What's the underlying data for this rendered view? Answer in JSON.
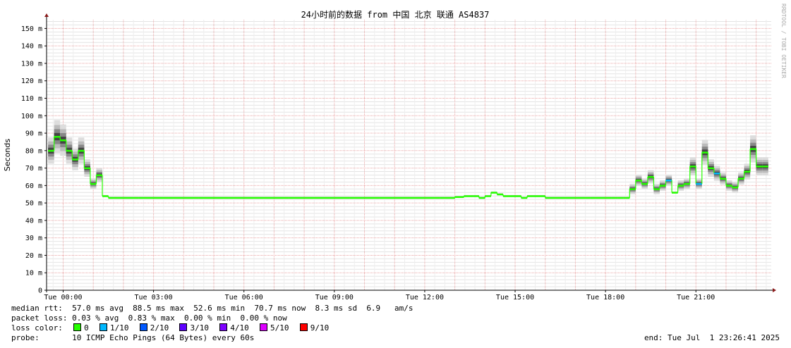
{
  "chart_data": {
    "type": "line",
    "title": "24小时前的数据 from 中国 北京 联通 AS4837",
    "ylabel": "Seconds",
    "watermark": "RRDTOOL / TOBI OETIKER",
    "ylim": [
      0,
      155
    ],
    "xlim": [
      -0.55,
      23.5
    ],
    "yticks": [
      {
        "v": 0,
        "label": "0"
      },
      {
        "v": 10,
        "label": "10 m"
      },
      {
        "v": 20,
        "label": "20 m"
      },
      {
        "v": 30,
        "label": "30 m"
      },
      {
        "v": 40,
        "label": "40 m"
      },
      {
        "v": 50,
        "label": "50 m"
      },
      {
        "v": 60,
        "label": "60 m"
      },
      {
        "v": 70,
        "label": "70 m"
      },
      {
        "v": 80,
        "label": "80 m"
      },
      {
        "v": 90,
        "label": "90 m"
      },
      {
        "v": 100,
        "label": "100 m"
      },
      {
        "v": 110,
        "label": "110 m"
      },
      {
        "v": 120,
        "label": "120 m"
      },
      {
        "v": 130,
        "label": "130 m"
      },
      {
        "v": 140,
        "label": "140 m"
      },
      {
        "v": 150,
        "label": "150 m"
      }
    ],
    "xticks": [
      {
        "v": 0,
        "label": "Tue 00:00"
      },
      {
        "v": 3,
        "label": "Tue 03:00"
      },
      {
        "v": 6,
        "label": "Tue 06:00"
      },
      {
        "v": 9,
        "label": "Tue 09:00"
      },
      {
        "v": 12,
        "label": "Tue 12:00"
      },
      {
        "v": 15,
        "label": "Tue 15:00"
      },
      {
        "v": 18,
        "label": "Tue 18:00"
      },
      {
        "v": 21,
        "label": "Tue 21:00"
      }
    ],
    "series": [
      {
        "x": [
          -0.5,
          -0.3,
          -0.1,
          0.1,
          0.3,
          0.5,
          0.7,
          0.9,
          1.1,
          1.3,
          1.5,
          1.7,
          2,
          2.5,
          3,
          3.5,
          4,
          4.5,
          5,
          5.5,
          6,
          6.5,
          7,
          7.5,
          8,
          8.5,
          9,
          9.5,
          10,
          10.5,
          11,
          11.5,
          12,
          12.5,
          13,
          13.3,
          13.6,
          13.8,
          14,
          14.2,
          14.4,
          14.6,
          14.8,
          15,
          15.2,
          15.4,
          15.6,
          16,
          16.5,
          17,
          17.5,
          18,
          18.2,
          18.4,
          18.6,
          18.8,
          19,
          19.2,
          19.4,
          19.6,
          19.8,
          20,
          20.2,
          20.4,
          20.6,
          20.8,
          21,
          21.2,
          21.4,
          21.6,
          21.8,
          22,
          22.2,
          22.4,
          22.6,
          22.8,
          23,
          23.2
        ],
        "y": [
          80,
          88,
          86,
          80,
          75,
          80,
          70,
          61,
          66,
          54,
          53,
          53,
          53,
          53,
          53,
          53,
          53,
          53,
          53,
          53,
          53,
          53,
          53,
          53,
          53,
          53,
          53,
          53,
          53,
          53,
          53,
          53,
          53,
          53,
          53.5,
          54,
          54,
          53,
          54,
          56,
          55,
          54,
          54,
          54,
          53,
          54,
          54,
          53,
          53,
          53,
          53,
          53,
          53,
          53,
          53,
          58,
          63,
          61,
          65,
          58,
          60,
          63,
          56,
          60,
          61,
          71,
          61,
          79,
          70,
          67,
          64,
          60,
          59,
          64,
          68,
          81,
          71,
          71
        ]
      }
    ]
  },
  "legend": {
    "median_rtt": "median rtt:  57.0 ms avg  88.5 ms max  52.6 ms min  70.7 ms now  8.3 ms sd  6.9   am/s",
    "packet_loss": "packet loss: 0.03 % avg  0.83 % max  0.00 % min  0.00 % now",
    "loss_color_label": "loss color:",
    "loss_colors": [
      {
        "label": "0",
        "color": "#26ff00"
      },
      {
        "label": "1/10",
        "color": "#00b8ff"
      },
      {
        "label": "2/10",
        "color": "#0059ff"
      },
      {
        "label": "3/10",
        "color": "#5e00ff"
      },
      {
        "label": "4/10",
        "color": "#7e00ff"
      },
      {
        "label": "5/10",
        "color": "#dd00ff"
      },
      {
        "label": "9/10",
        "color": "#ff0000"
      }
    ],
    "probe_label": "probe:",
    "probe": "10 ICMP Echo Pings (64 Bytes) every 60s",
    "end": "end: Tue Jul  1 23:26:41 2025"
  }
}
